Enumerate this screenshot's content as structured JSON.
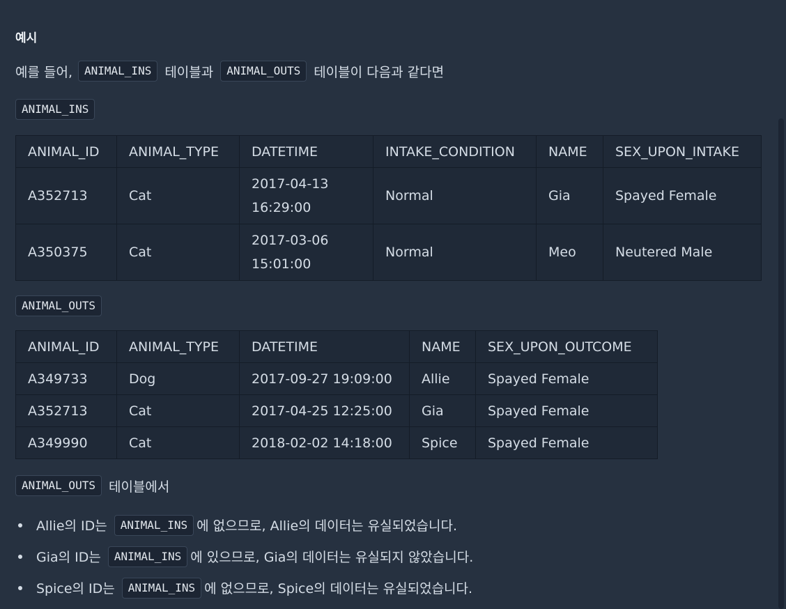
{
  "section_title": "예시",
  "intro": {
    "pre": "예를 들어,",
    "code1": "ANIMAL_INS",
    "mid": "테이블과",
    "code2": "ANIMAL_OUTS",
    "post": "테이블이 다음과 같다면"
  },
  "table_ins": {
    "label": "ANIMAL_INS",
    "headers": [
      "ANIMAL_ID",
      "ANIMAL_TYPE",
      "DATETIME",
      "INTAKE_CONDITION",
      "NAME",
      "SEX_UPON_INTAKE"
    ],
    "rows": [
      [
        "A352713",
        "Cat",
        "2017-04-13 16:29:00",
        "Normal",
        "Gia",
        "Spayed Female"
      ],
      [
        "A350375",
        "Cat",
        "2017-03-06 15:01:00",
        "Normal",
        "Meo",
        "Neutered Male"
      ]
    ]
  },
  "table_outs": {
    "label": "ANIMAL_OUTS",
    "headers": [
      "ANIMAL_ID",
      "ANIMAL_TYPE",
      "DATETIME",
      "NAME",
      "SEX_UPON_OUTCOME"
    ],
    "rows": [
      [
        "A349733",
        "Dog",
        "2017-09-27 19:09:00",
        "Allie",
        "Spayed Female"
      ],
      [
        "A352713",
        "Cat",
        "2017-04-25 12:25:00",
        "Gia",
        "Spayed Female"
      ],
      [
        "A349990",
        "Cat",
        "2018-02-02 14:18:00",
        "Spice",
        "Spayed Female"
      ]
    ]
  },
  "outs_line": {
    "code": "ANIMAL_OUTS",
    "post": "테이블에서"
  },
  "bullets": [
    {
      "pre": "Allie의 ID는",
      "code": "ANIMAL_INS",
      "post": "에 없으므로, Allie의 데이터는 유실되었습니다."
    },
    {
      "pre": "Gia의 ID는",
      "code": "ANIMAL_INS",
      "post": "에 있으므로, Gia의 데이터는 유실되지 않았습니다."
    },
    {
      "pre": "Spice의 ID는",
      "code": "ANIMAL_INS",
      "post": "에 없으므로, Spice의 데이터는 유실되었습니다."
    }
  ]
}
